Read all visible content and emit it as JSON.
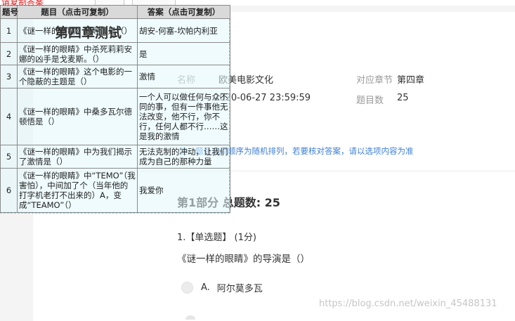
{
  "page": {
    "exam_title": "第四章测试",
    "top_hint": "请复制答案"
  },
  "info": {
    "name_label": "名称",
    "name_value": "欧美电影文化",
    "chapter_label": "对应章节",
    "chapter_value": "第四章",
    "deadline_value": "2020-06-27 23:59:59",
    "count_label": "题目数",
    "count_value": "25"
  },
  "notice": "注：题目选项顺序为随机排列，若要核对答案，请以选项内容为准",
  "part": {
    "title": "第1部分  总题数: 25"
  },
  "question": {
    "meta": "1.【单选题】 (1分)",
    "text": "《谜一样的眼睛》的导演是（）",
    "option_letter": "A.",
    "option_text": "阿尔莫多瓦"
  },
  "watermark": "https://blog.csdn.net/weixin_45488131",
  "answer_table": {
    "headers": [
      "题号",
      "题目（点击可复制）",
      "答案（点击可复制）"
    ],
    "rows": [
      {
        "num": "1",
        "question": "《谜一样的眼睛》的导演是（）",
        "answer": "胡安-何塞-坎帕内利亚"
      },
      {
        "num": "2",
        "question": "《谜一样的眼睛》中杀死莉莉安娜的凶手是戈麦斯。（）",
        "answer": "是"
      },
      {
        "num": "3",
        "question": "《谜一样的眼睛》这个电影的一个隐蔽的主题是（）",
        "answer": "激情"
      },
      {
        "num": "4",
        "question": "《谜一样的眼睛》中桑多瓦尔德顿悟是（）",
        "answer": "一个人可以做任何与众不同的事，但有一件事他无法改变，他不行，你不行，任何人都不行……这是我的激情"
      },
      {
        "num": "5",
        "question": "《谜一样的眼睛》中为我们揭示了激情是（）",
        "answer": "无法克制的冲动，让我们成为自己的那种力量"
      },
      {
        "num": "6",
        "question": "《谜一样的眼睛》中“TEMO”（我害怕），中间加了个（当年他的打字机老打不出来的）A，变成“TEAMO”（）",
        "answer": "我爱你"
      }
    ]
  }
}
